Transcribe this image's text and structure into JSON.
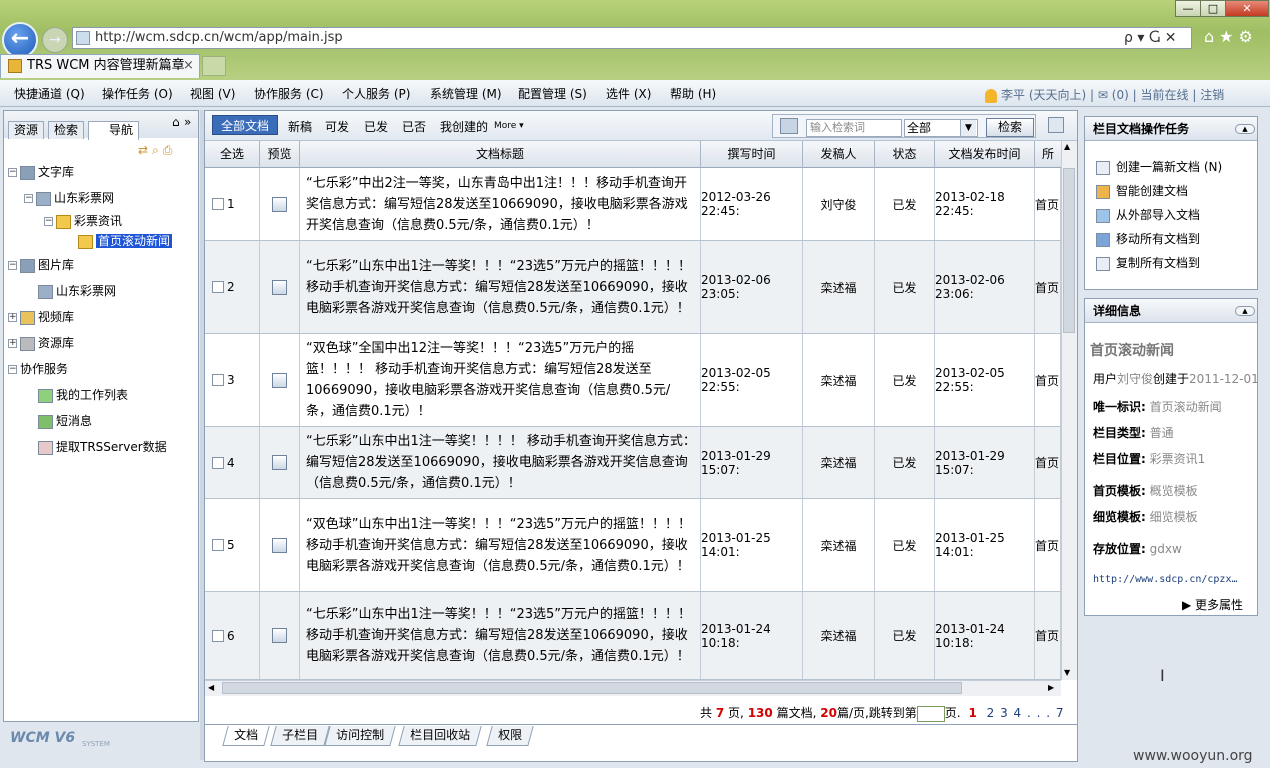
{
  "browser": {
    "url": "http://wcm.sdcp.cn/wcm/app/main.jsp",
    "tab_title": "TRS WCM 内容管理新篇章",
    "tab_close": "×",
    "addr_tools": "ρ ▾ Ⴚ ✕",
    "home_icons": "⌂★⚙",
    "back": "←",
    "forward": "→",
    "win_min": "—",
    "win_max": "□",
    "win_close": "✕"
  },
  "menu": [
    "快捷通道 (Q)",
    "操作任务 (O)",
    "视图 (V)",
    "协作服务 (C)",
    "个人服务 (P)",
    "系统管理 (M)",
    "配置管理 (S)",
    "选件 (X)",
    "帮助 (H)"
  ],
  "user_bar": {
    "user": "李平 (天天向上)",
    "sep1": "|",
    "mail": "✉ (0)",
    "sep2": "|",
    "online": "当前在线",
    "sep3": "|",
    "logout": "注销"
  },
  "left_tabs": {
    "resources": "资源",
    "search": "检索",
    "nav": "导航",
    "more": "»"
  },
  "tree": [
    {
      "label": "文字库"
    },
    {
      "label": "山东彩票网"
    },
    {
      "label": "彩票资讯"
    },
    {
      "label": "首页滚动新闻"
    },
    {
      "label": "图片库"
    },
    {
      "label": "山东彩票网"
    },
    {
      "label": "视频库"
    },
    {
      "label": "资源库"
    },
    {
      "label": "协作服务"
    },
    {
      "label": "我的工作列表"
    },
    {
      "label": "短消息"
    },
    {
      "label": "提取TRSServer数据"
    }
  ],
  "tree_expanders": {
    "minus": "−",
    "plus": "+"
  },
  "logo": {
    "text": "WCM V6",
    "system": "SYSTEM"
  },
  "toolbar": {
    "all": "全部文档",
    "items": [
      "新稿",
      "可发",
      "已发",
      "已否",
      "我创建的",
      "More ▾"
    ]
  },
  "search": {
    "placeholder": "输入检索词",
    "scope": "全部",
    "scope_arrow": "▼",
    "button": "检索"
  },
  "table": {
    "headers": [
      "全选",
      "预览",
      "文档标题",
      "撰写时间",
      "发稿人",
      "状态",
      "文档发布时间",
      "所"
    ],
    "rows": [
      {
        "num": "1",
        "title": "“七乐彩”中出2注一等奖，山东青岛中出1注！！！移动手机查询开奖信息方式：编写短信28发送至10669090，接收电脑彩票各游戏开奖信息查询（信息费0.5元/条，通信费0.1元）！",
        "written": "2012-03-26 22:45:",
        "author": "刘守俊",
        "status": "已发",
        "published": "2013-02-18 22:45:",
        "loc": "首页"
      },
      {
        "num": "2",
        "title": "“七乐彩”山东中出1注一等奖！！！“23选5”万元户的摇篮！！！！ 移动手机查询开奖信息方式：编写短信28发送至10669090，接收电脑彩票各游戏开奖信息查询（信息费0.5元/条，通信费0.1元）！",
        "written": "2013-02-06 23:05:",
        "author": "栾述福",
        "status": "已发",
        "published": "2013-02-06 23:06:",
        "loc": "首页"
      },
      {
        "num": "3",
        "title": "“双色球”全国中出12注一等奖！！！“23选5”万元户的摇篮！！！！ 移动手机查询开奖信息方式：编写短信28发送至10669090，接收电脑彩票各游戏开奖信息查询（信息费0.5元/条，通信费0.1元）！",
        "written": "2013-02-05 22:55:",
        "author": "栾述福",
        "status": "已发",
        "published": "2013-02-05 22:55:",
        "loc": "首页"
      },
      {
        "num": "4",
        "title": "“七乐彩”山东中出1注一等奖！！！！ 移动手机查询开奖信息方式：编写短信28发送至10669090，接收电脑彩票各游戏开奖信息查询（信息费0.5元/条，通信费0.1元）！",
        "written": "2013-01-29 15:07:",
        "author": "栾述福",
        "status": "已发",
        "published": "2013-01-29 15:07:",
        "loc": "首页"
      },
      {
        "num": "5",
        "title": "“双色球”山东中出1注一等奖！！！“23选5”万元户的摇篮！！！！ 移动手机查询开奖信息方式：编写短信28发送至10669090，接收电脑彩票各游戏开奖信息查询（信息费0.5元/条，通信费0.1元）！",
        "written": "2013-01-25 14:01:",
        "author": "栾述福",
        "status": "已发",
        "published": "2013-01-25 14:01:",
        "loc": "首页"
      },
      {
        "num": "6",
        "title": "“七乐彩”山东中出1注一等奖！！！“23选5”万元户的摇篮！！！！ 移动手机查询开奖信息方式：编写短信28发送至10669090，接收电脑彩票各游戏开奖信息查询（信息费0.5元/条，通信费0.1元）！",
        "written": "2013-01-24 10:18:",
        "author": "栾述福",
        "status": "已发",
        "published": "2013-01-24 10:18:",
        "loc": "首页"
      }
    ]
  },
  "scroll": {
    "up": "▲",
    "down": "▼",
    "left": "◀",
    "right": "▶"
  },
  "pager": {
    "p1": "共",
    "pages": "7",
    "p2": "页,",
    "docs": "130",
    "p3": "篇文档,",
    "per": "20",
    "p4": "篇/页,跳转到第",
    "p5": "页.",
    "current": "1",
    "others": "2 3 4 . . . 7"
  },
  "bottom_tabs": [
    "文档",
    "子栏目",
    "访问控制",
    "栏目回收站",
    "权限"
  ],
  "tasks_panel": {
    "title": "栏目文档操作任务",
    "items": [
      "创建一篇新文档 (N)",
      "智能创建文档",
      "从外部导入文档",
      "移动所有文档到",
      "复制所有文档到"
    ]
  },
  "collapse_glyph": "▲",
  "detail_panel": {
    "title": "详细信息",
    "name": "首页滚动新闻",
    "created_prefix": "用户",
    "created_user": "刘守俊",
    "created_mid": "创建于",
    "created_date": "2011-12-01",
    "fields": [
      {
        "label": "唯一标识:",
        "value": "首页滚动新闻"
      },
      {
        "label": "栏目类型:",
        "value": "普通"
      },
      {
        "label": "栏目位置:",
        "value": "彩票资讯1"
      },
      {
        "label": "首页模板:",
        "value": "概览模板"
      },
      {
        "label": "细览模板:",
        "value": "细览模板"
      },
      {
        "label": "存放位置:",
        "value": "gdxw"
      }
    ],
    "url": "http://www.sdcp.cn/cpzx…",
    "more": "▶ 更多属性"
  },
  "watermark": "www.wooyun.org",
  "cursor": "I"
}
